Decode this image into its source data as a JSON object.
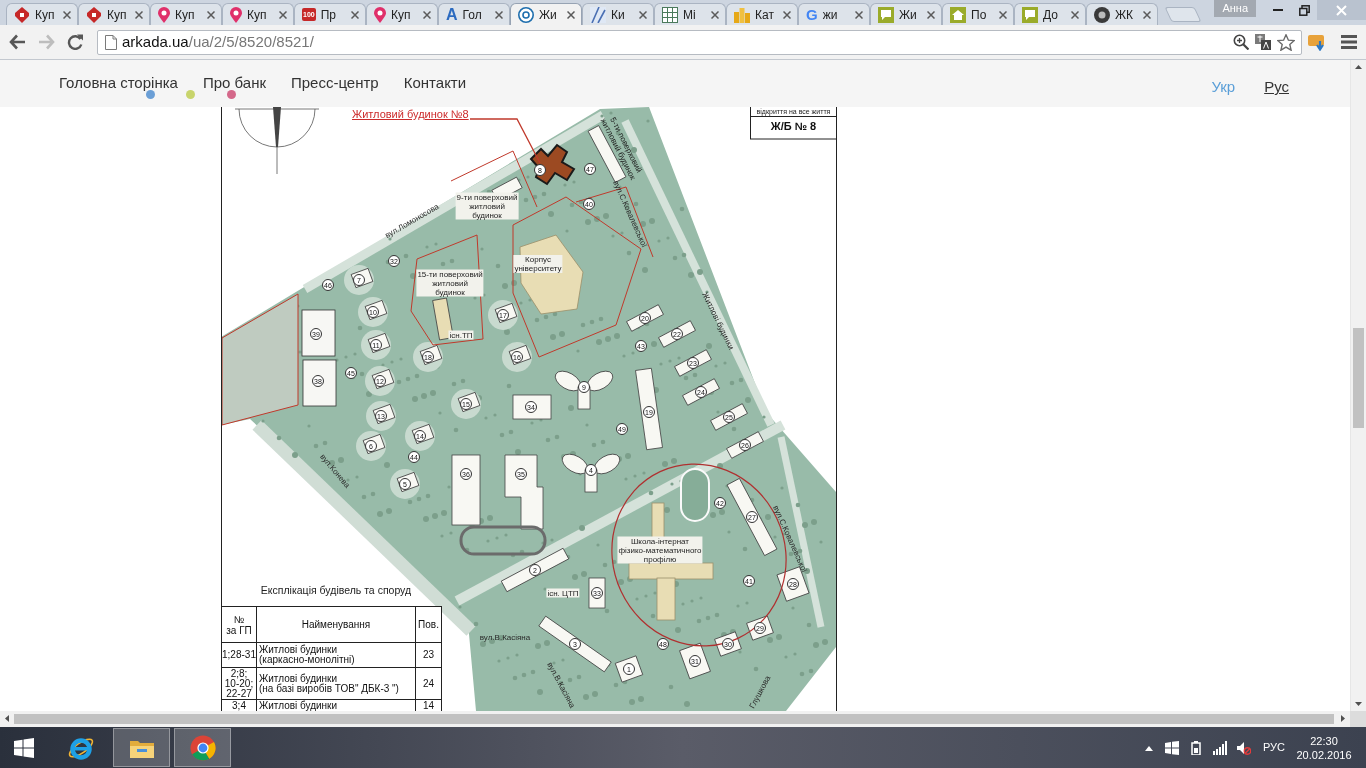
{
  "browser": {
    "tabs": [
      {
        "title": "Куп",
        "selected": false
      },
      {
        "title": "Куп",
        "selected": false
      },
      {
        "title": "Куп",
        "selected": false
      },
      {
        "title": "Куп",
        "selected": false
      },
      {
        "title": "Пр",
        "selected": false,
        "icon_text": "100"
      },
      {
        "title": "Куп",
        "selected": false
      },
      {
        "title": "Гол",
        "selected": false,
        "icon_text": "A"
      },
      {
        "title": "Жи",
        "selected": true
      },
      {
        "title": "Ки",
        "selected": false
      },
      {
        "title": "Мі",
        "selected": false
      },
      {
        "title": "Кат",
        "selected": false
      },
      {
        "title": "жи",
        "selected": false,
        "icon_text": "G"
      },
      {
        "title": "Жи",
        "selected": false
      },
      {
        "title": "По",
        "selected": false
      },
      {
        "title": "До",
        "selected": false
      },
      {
        "title": "ЖК",
        "selected": false
      }
    ],
    "profile": "Анна",
    "toolbar": {
      "buttons": [
        {
          "kind": "back",
          "disabled": false
        },
        {
          "kind": "forward",
          "disabled": true
        },
        {
          "kind": "reload",
          "disabled": false
        }
      ]
    },
    "address": {
      "host": "arkada.ua",
      "path": "/ua/2/5/8520/8521/"
    }
  },
  "site": {
    "nav": [
      "Головна сторінка",
      "Про банк",
      "Пресс-центр",
      "Контакти"
    ],
    "languages": [
      {
        "label": "Укр",
        "selected": true
      },
      {
        "label": "Рус",
        "selected": false
      }
    ]
  },
  "site_plan": {
    "callout": "Житловий будинок №8",
    "stamp": {
      "caption": "відкриття на все життя",
      "code": "Ж/Б № 8"
    },
    "labels": [
      {
        "kind": "building",
        "text": "5-ти поверховий\nжитловий будинок"
      },
      {
        "kind": "building",
        "text": "9-ти поверховий\nжитловий\nбудинок"
      },
      {
        "kind": "street",
        "text": "вул.Ломоносова"
      },
      {
        "kind": "street",
        "text": "вул.С.Ковалевської"
      },
      {
        "kind": "building",
        "text": "Корпус\nуніверситету"
      },
      {
        "kind": "building",
        "text": "15-ти поверховий\nжитловий\nбудинок"
      },
      {
        "kind": "building",
        "text": "Житлові будинки"
      },
      {
        "kind": "building",
        "text": "існ.ТП"
      },
      {
        "kind": "street",
        "text": "вул.Конева"
      },
      {
        "kind": "building",
        "text": "Школа-інтернат\nфізико-математичного\nпрофілю"
      },
      {
        "kind": "street",
        "text": "вул.С.Ковалевської"
      },
      {
        "kind": "building",
        "text": "існ. ЦТП"
      },
      {
        "kind": "street",
        "text": "вул.В.Касіяна"
      },
      {
        "kind": "street",
        "text": "вул.В.Касіяна"
      },
      {
        "kind": "street",
        "text": "Глушкова"
      }
    ],
    "building_numbers": [
      "8",
      "47",
      "40",
      "32",
      "46",
      "7",
      "10",
      "17",
      "20",
      "39",
      "22",
      "11",
      "43",
      "18",
      "16",
      "23",
      "45",
      "38",
      "12",
      "9",
      "24",
      "15",
      "34",
      "13",
      "19",
      "25",
      "49",
      "14",
      "6",
      "26",
      "44",
      "36",
      "35",
      "4",
      "5",
      "42",
      "27",
      "2",
      "41",
      "28",
      "33",
      "29",
      "3",
      "48",
      "30",
      "31",
      "1"
    ],
    "explication": {
      "title": "Експлікація будівель та споруд",
      "columns": [
        "№\nза ГП",
        "Найменування",
        "Пов."
      ],
      "rows": [
        [
          "1;28-31",
          "Житлові будинки\n(каркасно-монолітні)",
          "23"
        ],
        [
          "2;8;\n10-20;\n22-27",
          "Житлові будинки\n(на базі виробів ТОВ\" ДБК-3 \")",
          "24"
        ],
        [
          "3;4",
          "Житлові будинки",
          "14"
        ]
      ]
    }
  },
  "taskbar": {
    "apps": [
      {
        "kind": "ie",
        "running": false
      },
      {
        "kind": "explorer",
        "running": true
      },
      {
        "kind": "chrome",
        "running": true
      }
    ],
    "language": "РУС",
    "time": "22:30",
    "date": "20.02.2016"
  }
}
